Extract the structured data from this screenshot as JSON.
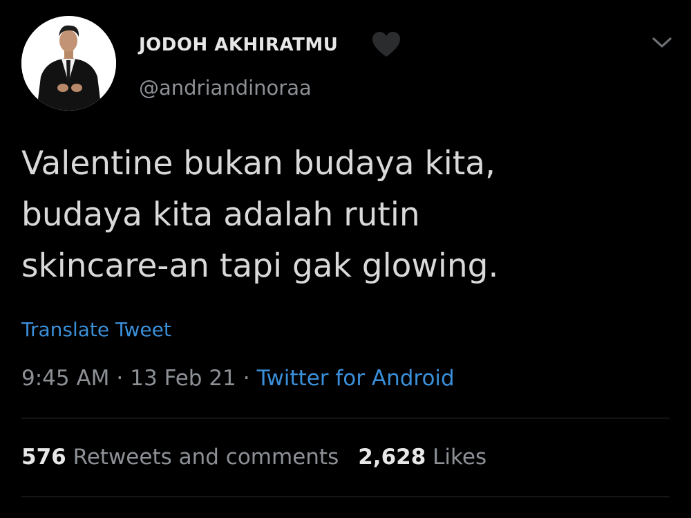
{
  "author": {
    "display_name": "JODOH AKHIRATMU",
    "handle": "@andriandinoraa",
    "name_emoji": "black-heart-icon"
  },
  "tweet": {
    "lines": [
      "Valentine bukan budaya kita,",
      "budaya kita adalah rutin",
      "skincare-an tapi gak glowing."
    ],
    "translate_label": "Translate Tweet",
    "time": "9:45 AM",
    "date": "13 Feb 21",
    "separator": "·",
    "source": "Twitter for Android"
  },
  "stats": {
    "retweets_count": "576",
    "retweets_label": "Retweets and comments",
    "likes_count": "2,628",
    "likes_label": "Likes"
  },
  "icons": {
    "menu": "chevron-down-icon",
    "avatar": "avatar"
  },
  "colors": {
    "background": "#000000",
    "text": "#d9d9d9",
    "muted": "#8d9196",
    "link": "#3b8fd9",
    "divider": "#2f3336"
  }
}
